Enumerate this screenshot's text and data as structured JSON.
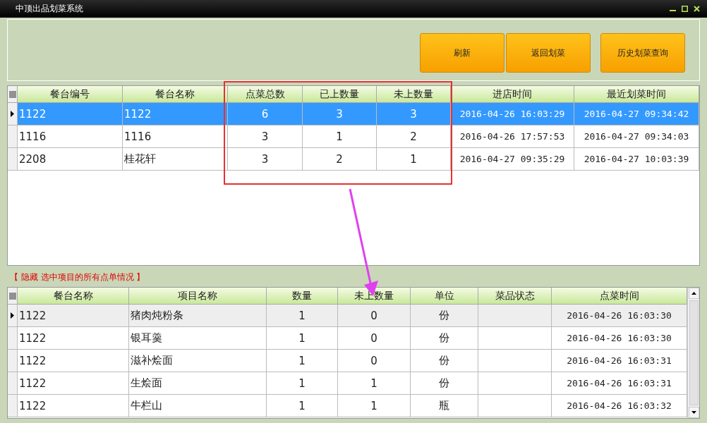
{
  "window": {
    "title": "中顶出品划菜系统"
  },
  "toolbar": {
    "buttons": [
      "刷新",
      "返回划菜",
      "历史划菜查询"
    ]
  },
  "tables_grid": {
    "columns": [
      "餐台编号",
      "餐台名称",
      "点菜总数",
      "已上数量",
      "未上数量",
      "进店时间",
      "最近划菜时间"
    ],
    "rows": [
      {
        "cells": [
          "1122",
          "1122",
          "6",
          "3",
          "3",
          "2016-04-26 16:03:29",
          "2016-04-27 09:34:42"
        ],
        "selected": true
      },
      {
        "cells": [
          "1116",
          "1116",
          "3",
          "1",
          "2",
          "2016-04-26 17:57:53",
          "2016-04-27 09:34:03"
        ],
        "selected": false
      },
      {
        "cells": [
          "2208",
          "桂花轩",
          "3",
          "2",
          "1",
          "2016-04-27 09:35:29",
          "2016-04-27 10:03:39"
        ],
        "selected": false
      }
    ]
  },
  "detail_toggle": "【 隐藏 选中项目的所有点单情况 】",
  "items_grid": {
    "columns": [
      "餐台名称",
      "项目名称",
      "数量",
      "未上数量",
      "单位",
      "菜品状态",
      "点菜时间"
    ],
    "rows": [
      {
        "cells": [
          "1122",
          "猪肉炖粉条",
          "1",
          "0",
          "份",
          "",
          "2016-04-26 16:03:30"
        ],
        "selected": true
      },
      {
        "cells": [
          "1122",
          "银耳羹",
          "1",
          "0",
          "份",
          "",
          "2016-04-26 16:03:30"
        ],
        "selected": false
      },
      {
        "cells": [
          "1122",
          "滋补烩面",
          "1",
          "0",
          "份",
          "",
          "2016-04-26 16:03:31"
        ],
        "selected": false
      },
      {
        "cells": [
          "1122",
          "生烩面",
          "1",
          "1",
          "份",
          "",
          "2016-04-26 16:03:31"
        ],
        "selected": false
      },
      {
        "cells": [
          "1122",
          "牛栏山",
          "1",
          "1",
          "瓶",
          "",
          "2016-04-26 16:03:32"
        ],
        "selected": false
      }
    ]
  }
}
